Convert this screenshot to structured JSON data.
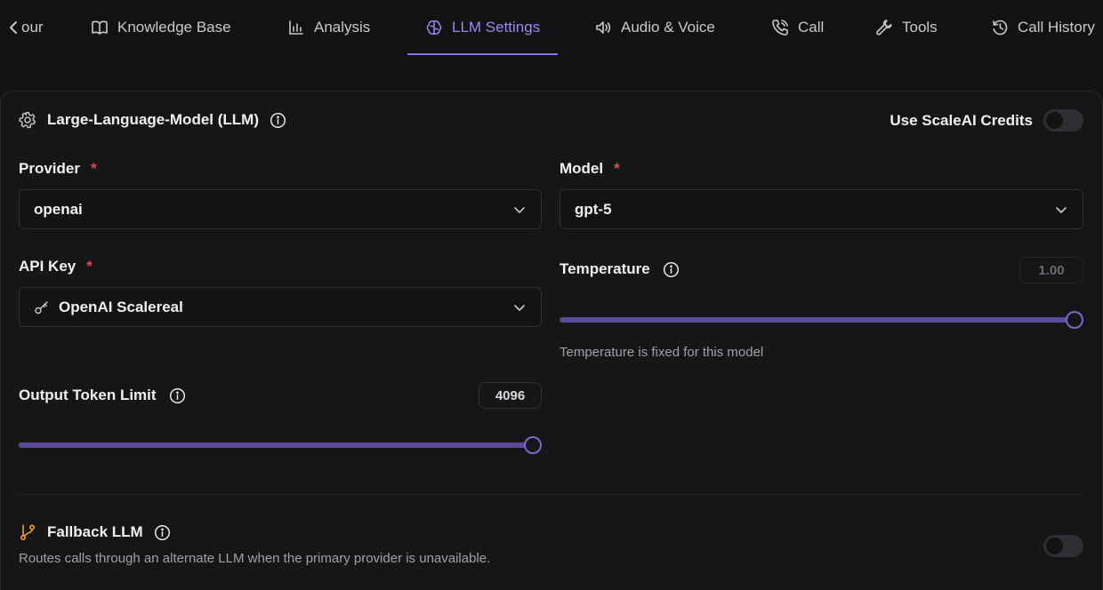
{
  "tabs": [
    {
      "label": "our",
      "icon": "chevron-left-icon"
    },
    {
      "label": "Knowledge Base",
      "icon": "book-icon"
    },
    {
      "label": "Analysis",
      "icon": "bar-chart-icon"
    },
    {
      "label": "LLM Settings",
      "icon": "brain-icon",
      "active": true
    },
    {
      "label": "Audio & Voice",
      "icon": "speaker-icon"
    },
    {
      "label": "Call",
      "icon": "phone-icon"
    },
    {
      "label": "Tools",
      "icon": "wrench-icon"
    },
    {
      "label": "Call History",
      "icon": "history-icon"
    }
  ],
  "llm": {
    "section_title": "Large-Language-Model (LLM)",
    "credits_label": "Use ScaleAI Credits",
    "credits_enabled": false,
    "provider": {
      "label": "Provider",
      "required": "*",
      "value": "openai"
    },
    "model": {
      "label": "Model",
      "required": "*",
      "value": "gpt-5"
    },
    "api_key": {
      "label": "API Key",
      "required": "*",
      "value": "OpenAI Scalereal"
    },
    "temperature": {
      "label": "Temperature",
      "value": "1.00",
      "level": 1.0,
      "hint": "Temperature is fixed for this model"
    },
    "output_tokens": {
      "label": "Output Token Limit",
      "value": "4096",
      "level": 1.0
    }
  },
  "fallback": {
    "title": "Fallback LLM",
    "description": "Routes calls through an alternate LLM when the primary provider is unavailable.",
    "enabled": false
  },
  "colors": {
    "accent": "#9c86f0",
    "required": "#e5484d",
    "fallback_icon": "#f0a020",
    "background": "#121214"
  }
}
